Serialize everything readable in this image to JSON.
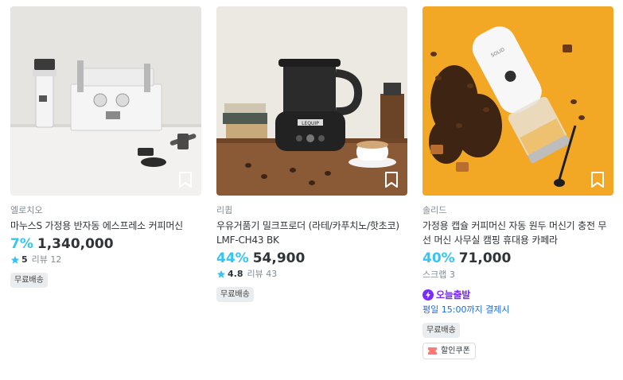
{
  "products": [
    {
      "brand": "엘로치오",
      "title": "마누스S 가정용 반자동 에스프레소 커피머신",
      "discount": "7%",
      "price": "1,340,000",
      "rating": "5",
      "reviews": "리뷰 12",
      "badges": [
        "무료배송"
      ]
    },
    {
      "brand": "리큅",
      "title": "우유거품기 밀크프로더 (라테/카푸치노/핫초코) LMF-CH43 BK",
      "discount": "44%",
      "price": "54,900",
      "rating": "4.8",
      "reviews": "리뷰 43",
      "badges": [
        "무료배송"
      ],
      "device_label": "LEQUIP"
    },
    {
      "brand": "솔리드",
      "title": "가정용 캡슐 커피머신 자동 원두 머신기 충전 무선 머신 사무실 캠핑 휴대용 카페라",
      "discount": "40%",
      "price": "71,000",
      "scrap": "스크랩 3",
      "today_label": "오늘출발",
      "today_note": "평일 15:00까지 결제시",
      "badges": [
        "무료배송"
      ],
      "coupon": "할인쿠폰",
      "device_label": "SOLID"
    }
  ],
  "colors": {
    "accent": "#35c5f0",
    "today": "#7a2cff",
    "today_note": "#1b6ce8",
    "text": "#2f3438",
    "muted": "#828c94",
    "star": "#35c5f0",
    "coupon": "#f77"
  }
}
